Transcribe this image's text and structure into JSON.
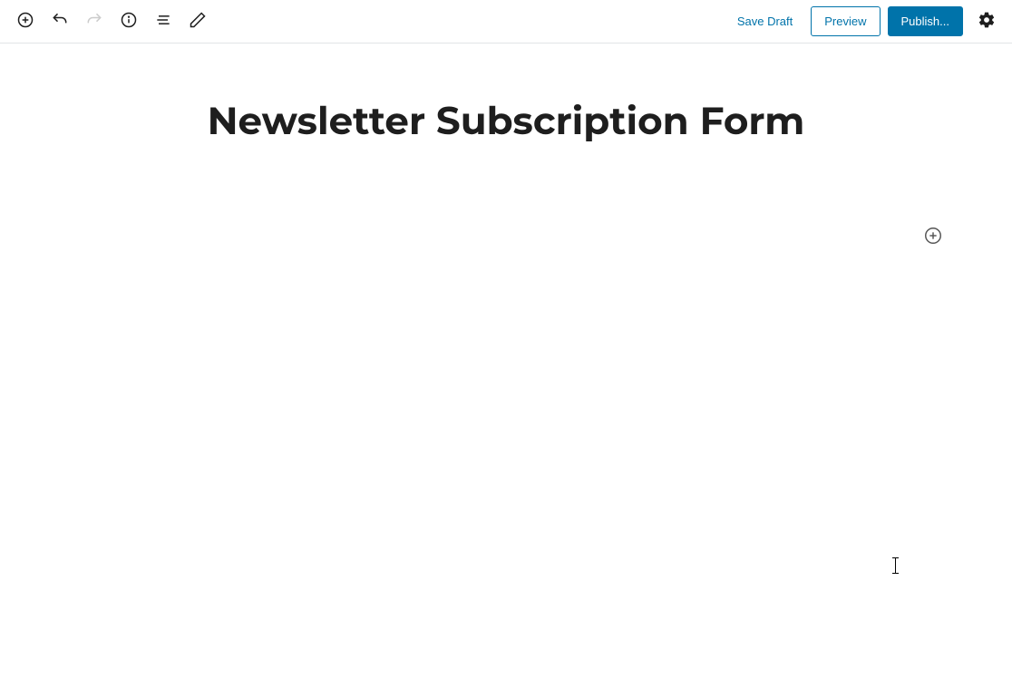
{
  "toolbar": {
    "save_draft_label": "Save Draft",
    "preview_label": "Preview",
    "publish_label": "Publish..."
  },
  "editor": {
    "title": "Newsletter Subscription Form"
  }
}
